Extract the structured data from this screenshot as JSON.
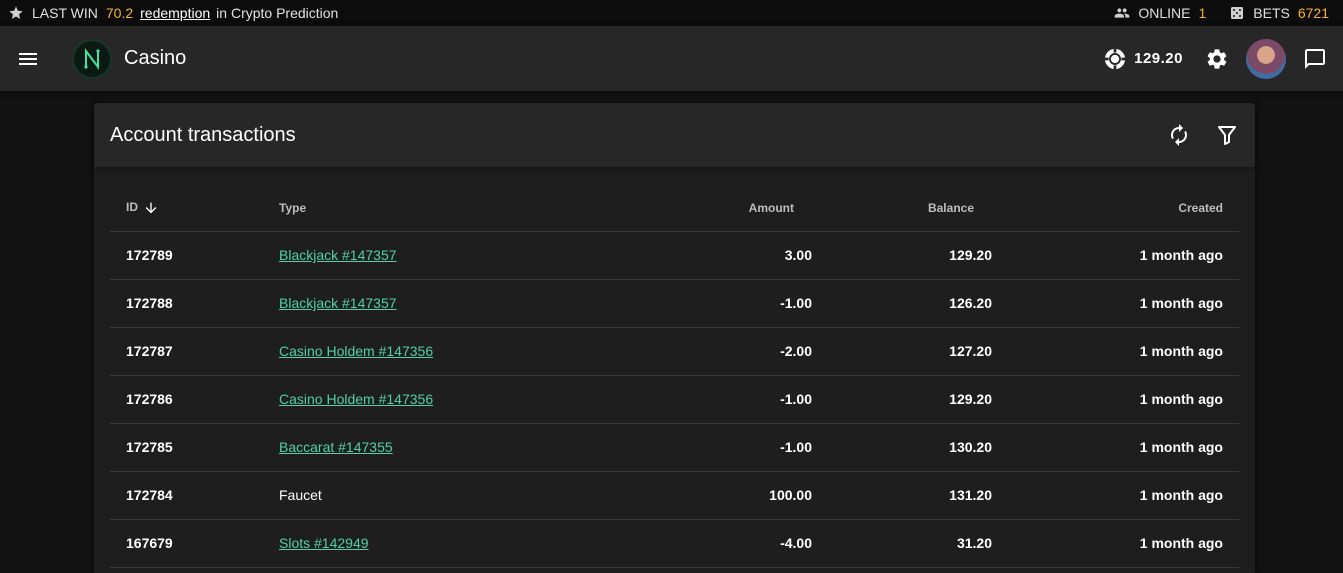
{
  "ticker": {
    "last_win_label": "LAST WIN",
    "last_win_amount": "70.2",
    "last_win_user": "redemption",
    "last_win_game": "in Crypto Prediction",
    "online_label": "ONLINE",
    "online_count": "1",
    "bets_label": "BETS",
    "bets_count": "6721"
  },
  "appbar": {
    "title": "Casino",
    "logo_letter": "N",
    "balance": "129.20"
  },
  "card": {
    "title": "Account transactions"
  },
  "table": {
    "headers": {
      "id": "ID",
      "type": "Type",
      "amount": "Amount",
      "balance": "Balance",
      "created": "Created"
    },
    "rows": [
      {
        "id": "172789",
        "type": "Blackjack #147357",
        "link": true,
        "amount": "3.00",
        "balance": "129.20",
        "created": "1 month ago"
      },
      {
        "id": "172788",
        "type": "Blackjack #147357",
        "link": true,
        "amount": "-1.00",
        "balance": "126.20",
        "created": "1 month ago"
      },
      {
        "id": "172787",
        "type": "Casino Holdem #147356",
        "link": true,
        "amount": "-2.00",
        "balance": "127.20",
        "created": "1 month ago"
      },
      {
        "id": "172786",
        "type": "Casino Holdem #147356",
        "link": true,
        "amount": "-1.00",
        "balance": "129.20",
        "created": "1 month ago"
      },
      {
        "id": "172785",
        "type": "Baccarat #147355",
        "link": true,
        "amount": "-1.00",
        "balance": "130.20",
        "created": "1 month ago"
      },
      {
        "id": "172784",
        "type": "Faucet",
        "link": false,
        "amount": "100.00",
        "balance": "131.20",
        "created": "1 month ago"
      },
      {
        "id": "167679",
        "type": "Slots #142949",
        "link": true,
        "amount": "-4.00",
        "balance": "31.20",
        "created": "1 month ago"
      }
    ]
  },
  "colors": {
    "accent": "#f5b32f",
    "link": "#4fd1a5",
    "appbar": "#272727",
    "background": "#121212"
  },
  "icons": {
    "last_win": "star-icon",
    "online": "people-icon",
    "bets": "dice-icon",
    "menu": "menu-icon",
    "balance": "poker-chip-icon",
    "settings": "gear-icon",
    "chat": "chat-icon",
    "refresh": "refresh-icon",
    "filter": "filter-icon",
    "sort": "arrow-down-icon"
  }
}
